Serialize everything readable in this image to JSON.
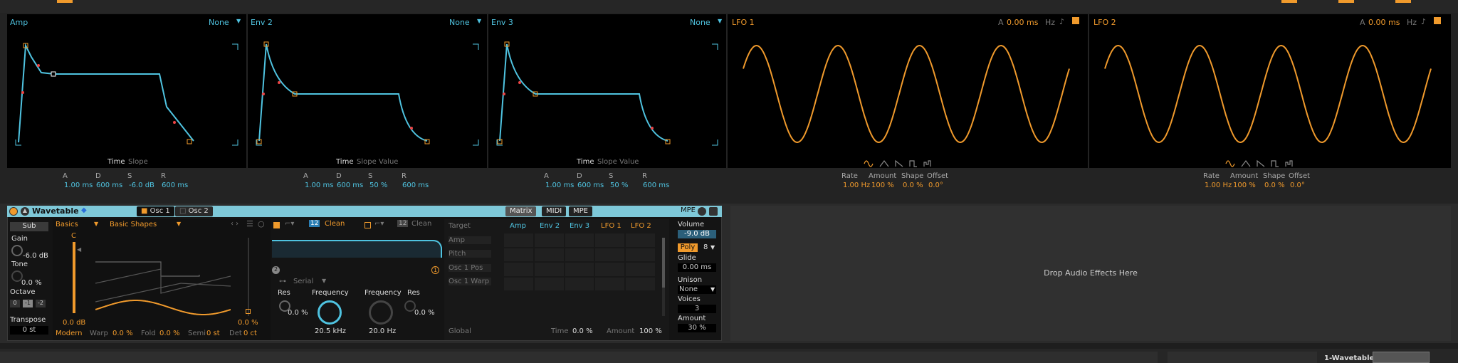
{
  "amp": {
    "title": "Amp",
    "mode": "None",
    "tabs": [
      "Time",
      "Slope"
    ],
    "labels": [
      "A",
      "D",
      "S",
      "R"
    ],
    "values": [
      "1.00 ms",
      "600 ms",
      "-6.0 dB",
      "600 ms"
    ]
  },
  "env2": {
    "title": "Env 2",
    "mode": "None",
    "tabs": [
      "Time",
      "Slope",
      "Value"
    ],
    "labels": [
      "A",
      "D",
      "S",
      "R"
    ],
    "values": [
      "1.00 ms",
      "600 ms",
      "50 %",
      "600 ms"
    ]
  },
  "env3": {
    "title": "Env 3",
    "mode": "None",
    "tabs": [
      "Time",
      "Slope",
      "Value"
    ],
    "labels": [
      "A",
      "D",
      "S",
      "R"
    ],
    "values": [
      "1.00 ms",
      "600 ms",
      "50 %",
      "600 ms"
    ]
  },
  "lfo1": {
    "title": "LFO 1",
    "a_label": "A",
    "a_value": "0.00 ms",
    "unit": "Hz",
    "labels": [
      "Rate",
      "Amount",
      "Shape",
      "Offset"
    ],
    "values": [
      "1.00 Hz",
      "100 %",
      "0.0 %",
      "0.0°"
    ]
  },
  "lfo2": {
    "title": "LFO 2",
    "a_label": "A",
    "a_value": "0.00 ms",
    "unit": "Hz",
    "labels": [
      "Rate",
      "Amount",
      "Shape",
      "Offset"
    ],
    "values": [
      "1.00 Hz",
      "100 %",
      "0.0 %",
      "0.0°"
    ]
  },
  "device": {
    "name": "Wavetable",
    "osc1": "Osc 1",
    "osc2": "Osc 2",
    "matrix": "Matrix",
    "midi": "MIDI",
    "mpe_tab": "MPE",
    "mpe": "MPE"
  },
  "sub": {
    "label": "Sub",
    "gain_label": "Gain",
    "gain": "-6.0 dB",
    "tone_label": "Tone",
    "tone": "0.0 %",
    "octave_label": "Octave",
    "octaves": [
      "0",
      "-1",
      "-2"
    ],
    "transpose_label": "Transpose",
    "transpose": "0 st"
  },
  "osc": {
    "category": "Basics",
    "wavetable": "Basic Shapes",
    "note": "C",
    "level": "0.0 dB",
    "pos": "0.0 %",
    "mode": "Modern",
    "warp_label": "Warp",
    "warp": "0.0 %",
    "fold_label": "Fold",
    "fold": "0.0 %",
    "semi_label": "Semi",
    "semi": "0 st",
    "det_label": "Det",
    "det": "0 ct"
  },
  "filter": {
    "type1_num": "12",
    "type1": "Clean",
    "type2_num": "12",
    "type2": "Clean",
    "routing": "Serial",
    "res_label": "Res",
    "res": "0.0 %",
    "freq_label": "Frequency",
    "freq": "20.5 kHz",
    "freq2_label": "Frequency",
    "freq2": "20.0 Hz",
    "res2_label": "Res",
    "res2": "0.0 %",
    "num1": "2",
    "num2": "1"
  },
  "matrix": {
    "target": "Target",
    "cols": [
      "Amp",
      "Env 2",
      "Env 3",
      "LFO 1",
      "LFO 2"
    ],
    "rows": [
      "Amp",
      "Pitch",
      "Osc 1 Pos",
      "Osc 1 Warp"
    ],
    "global": "Global",
    "time_label": "Time",
    "time": "0.0 %",
    "amount_label": "Amount",
    "amount": "100 %"
  },
  "global": {
    "volume_label": "Volume",
    "volume": "-9.0 dB",
    "poly": "Poly",
    "voices_count": "8",
    "glide_label": "Glide",
    "glide": "0.00 ms",
    "unison_label": "Unison",
    "unison": "None",
    "voices_label": "Voices",
    "voices": "3",
    "amount_label": "Amount",
    "amount": "30 %"
  },
  "fx": {
    "drop": "Drop Audio Effects Here"
  },
  "bottom": {
    "track": "1-Wavetable"
  }
}
